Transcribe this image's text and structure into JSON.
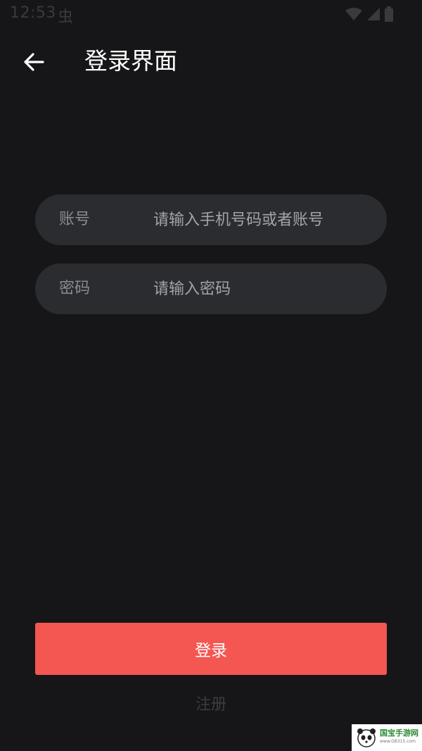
{
  "status_bar": {
    "time": "12:53",
    "bug_glyph": "虫"
  },
  "header": {
    "title": "登录界面",
    "back_icon": "arrow-left-icon"
  },
  "form": {
    "account": {
      "label": "账号",
      "placeholder": "请输入手机号码或者账号",
      "value": ""
    },
    "password": {
      "label": "密码",
      "placeholder": "请输入密码",
      "value": ""
    }
  },
  "actions": {
    "login_label": "登录",
    "register_label": "注册"
  },
  "watermark": {
    "brand": "国宝手游网",
    "url": "www.GB315.com"
  },
  "colors": {
    "background": "#161618",
    "field_bg": "#2b2c30",
    "accent": "#f45752"
  }
}
